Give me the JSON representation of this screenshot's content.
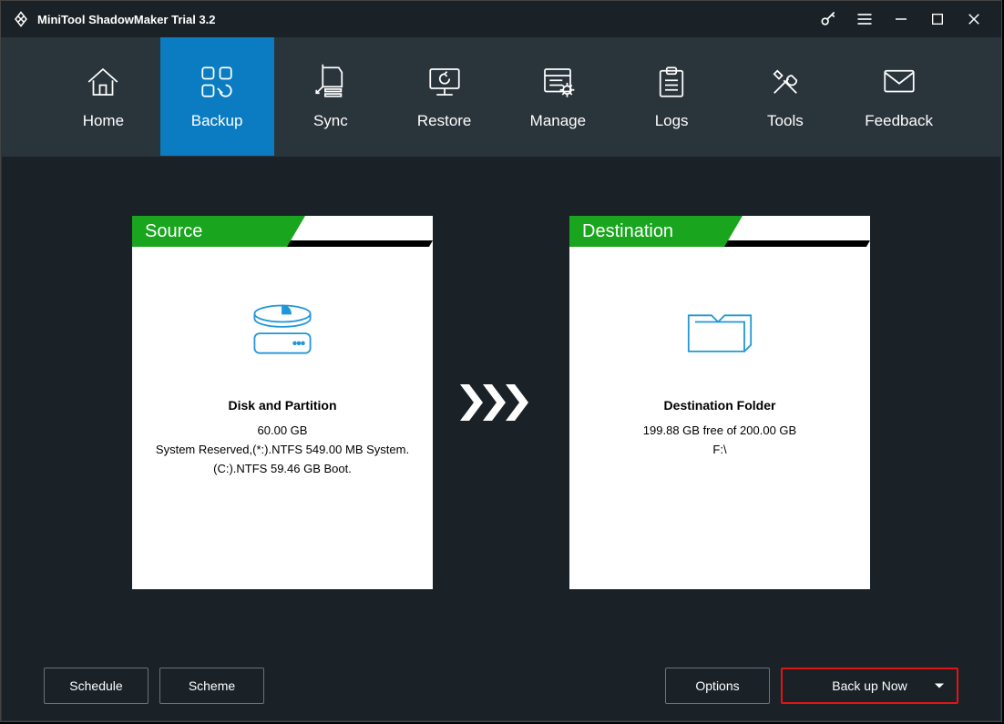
{
  "title": "MiniTool ShadowMaker Trial 3.2",
  "nav": [
    {
      "label": "Home"
    },
    {
      "label": "Backup"
    },
    {
      "label": "Sync"
    },
    {
      "label": "Restore"
    },
    {
      "label": "Manage"
    },
    {
      "label": "Logs"
    },
    {
      "label": "Tools"
    },
    {
      "label": "Feedback"
    }
  ],
  "source": {
    "header": "Source",
    "title": "Disk and Partition",
    "size": "60.00 GB",
    "detail1": "System Reserved,(*:).NTFS 549.00 MB System.",
    "detail2": "(C:).NTFS 59.46 GB Boot."
  },
  "destination": {
    "header": "Destination",
    "title": "Destination Folder",
    "free": "199.88 GB free of 200.00 GB",
    "path": "F:\\"
  },
  "buttons": {
    "schedule": "Schedule",
    "scheme": "Scheme",
    "options": "Options",
    "backup_now": "Back up Now"
  }
}
